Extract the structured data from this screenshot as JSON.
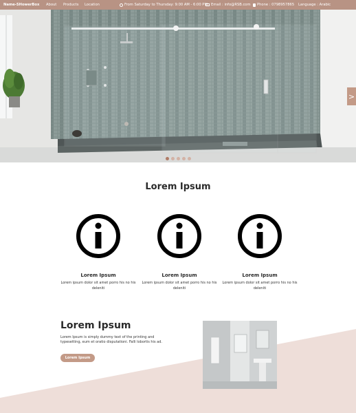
{
  "header": {
    "logo": "Name-SHowerBox",
    "nav": [
      {
        "label": "About"
      },
      {
        "label": "Products"
      },
      {
        "label": "Location"
      }
    ],
    "hours": "From Saturday to Thursday: 9:00 AM - 6:00 PM",
    "email": "Email : info@RSB.com",
    "phone": "Phone : 0798957865",
    "language": "Language : Arabic"
  },
  "hero": {
    "next_arrow": ">",
    "dots_count": 5,
    "active_dot": 0
  },
  "features": {
    "title": "Lorem Ipsum",
    "items": [
      {
        "icon": "info-icon",
        "title": "Lorem Ipsum",
        "text": "Lorem ipsum dolor sit amet porro his no his deleniti"
      },
      {
        "icon": "info-icon",
        "title": "Lorem Ipsum",
        "text": "Lorem ipsum dolor sit amet porro his no his deleniti"
      },
      {
        "icon": "info-icon",
        "title": "Lorem Ipsum",
        "text": "Lorem ipsum dolor sit amet porro his no his deleniti"
      }
    ]
  },
  "about": {
    "title": "Lorem Ipsum",
    "text": "Lorem Ipsum is simply dummy text of the printing and typesetting, eum et oratio disputationi. Falli lobortis his ad.",
    "button": "Lorem Ipsum"
  },
  "colors": {
    "accent": "#c39a87",
    "topbar": "#b89384",
    "bottom_shape": "#eeded9"
  }
}
